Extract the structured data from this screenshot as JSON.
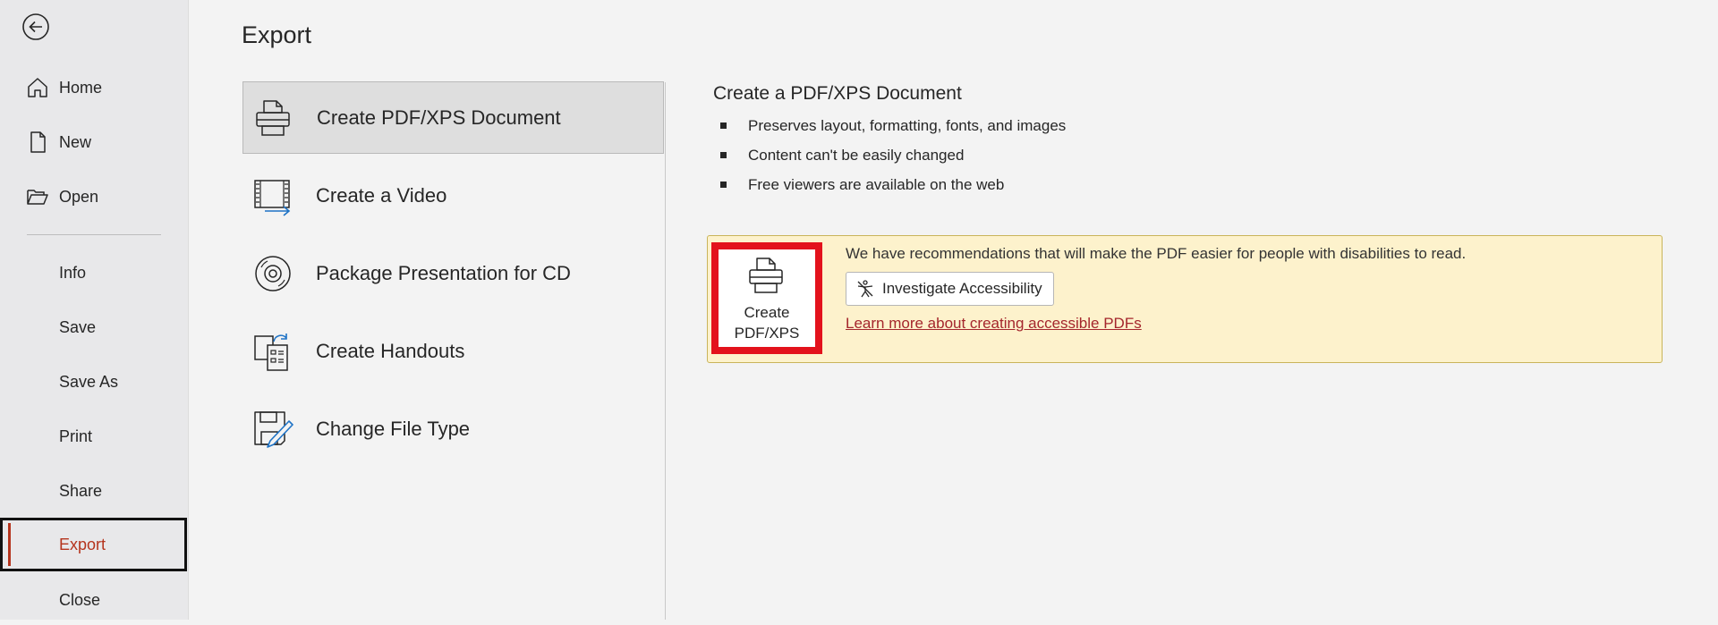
{
  "sidebar": {
    "back_icon": "back-arrow-icon",
    "items": [
      {
        "label": "Home",
        "icon": "home-icon"
      },
      {
        "label": "New",
        "icon": "new-document-icon"
      },
      {
        "label": "Open",
        "icon": "folder-open-icon"
      },
      {
        "label": "Info"
      },
      {
        "label": "Save"
      },
      {
        "label": "Save As"
      },
      {
        "label": "Print"
      },
      {
        "label": "Share"
      },
      {
        "label": "Export",
        "active": true
      },
      {
        "label": "Close"
      }
    ]
  },
  "main": {
    "title": "Export",
    "options": [
      {
        "label": "Create PDF/XPS Document",
        "icon": "pdf-xps-icon",
        "selected": true
      },
      {
        "label": "Create a Video",
        "icon": "video-icon"
      },
      {
        "label": "Package Presentation for CD",
        "icon": "cd-icon"
      },
      {
        "label": "Create Handouts",
        "icon": "handouts-icon"
      },
      {
        "label": "Change File Type",
        "icon": "change-file-type-icon"
      }
    ]
  },
  "detail": {
    "title": "Create a PDF/XPS Document",
    "bullets": [
      "Preserves layout, formatting, fonts, and images",
      "Content can't be easily changed",
      "Free viewers are available on the web"
    ],
    "recommendation": {
      "create_button_label": "Create\nPDF/XPS",
      "message": "We have recommendations that will make the PDF easier for people with disabilities to read.",
      "investigate_label": "Investigate Accessibility",
      "learn_more": "Learn more about creating accessible PDFs"
    }
  },
  "colors": {
    "sidebar_bg": "#e8e8ea",
    "page_bg": "#f3f3f3",
    "active_accent": "#b5341d",
    "highlight_border": "#e3121c",
    "recommendation_bg": "#fdf2cc",
    "link": "#a4262c"
  }
}
